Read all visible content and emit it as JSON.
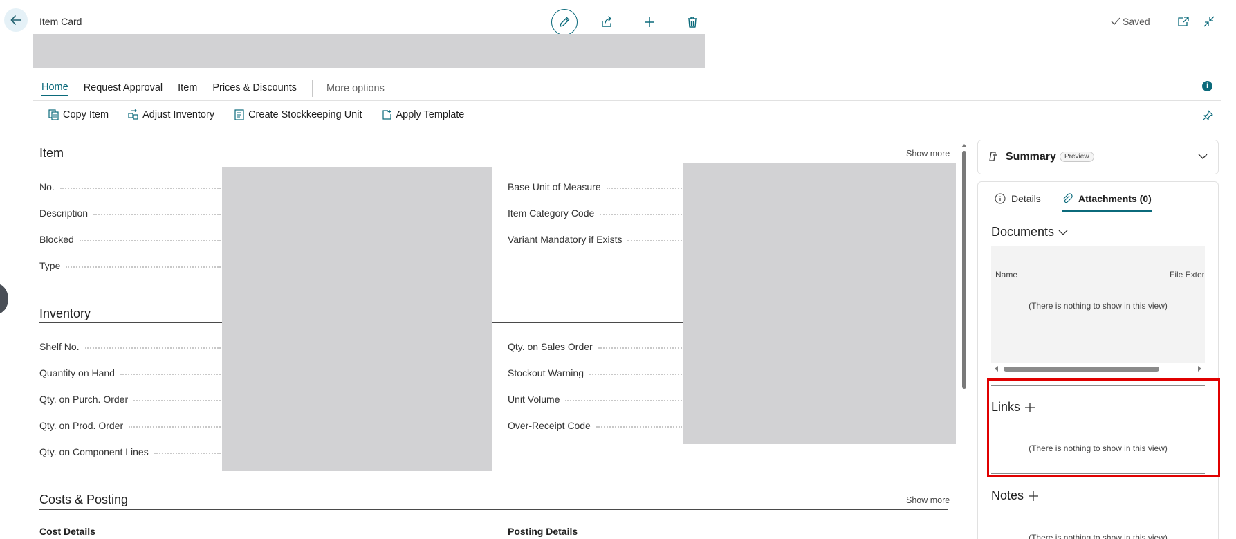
{
  "window": {
    "title": "Item Card",
    "status": "Saved"
  },
  "toolbar": {
    "back_label": "Back",
    "edit_label": "Edit",
    "share_label": "Share",
    "new_label": "New",
    "delete_label": "Delete"
  },
  "nav": {
    "tabs": [
      {
        "label": "Home",
        "active": true
      },
      {
        "label": "Request Approval",
        "active": false
      },
      {
        "label": "Item",
        "active": false
      },
      {
        "label": "Prices & Discounts",
        "active": false
      }
    ],
    "more": "More options"
  },
  "actions": [
    {
      "label": "Copy Item",
      "icon": "copy-icon"
    },
    {
      "label": "Adjust Inventory",
      "icon": "adjust-inventory-icon"
    },
    {
      "label": "Create Stockkeeping Unit",
      "icon": "stockkeeping-icon"
    },
    {
      "label": "Apply Template",
      "icon": "template-icon"
    }
  ],
  "item_section": {
    "title": "Item",
    "show_more": "Show more",
    "left_fields": [
      "No.",
      "Description",
      "Blocked",
      "Type"
    ],
    "right_fields": [
      "Base Unit of Measure",
      "Item Category Code",
      "Variant Mandatory if Exists"
    ]
  },
  "inventory_section": {
    "title": "Inventory",
    "left_fields": [
      "Shelf No.",
      "Quantity on Hand",
      "Qty. on Purch. Order",
      "Qty. on Prod. Order",
      "Qty. on Component Lines"
    ],
    "right_fields": [
      "Qty. on Sales Order",
      "Stockout Warning",
      "Unit Volume",
      "Over-Receipt Code"
    ]
  },
  "costs_section": {
    "title": "Costs & Posting",
    "show_more": "Show more",
    "sub_left": "Cost Details",
    "sub_right": "Posting Details"
  },
  "factbox": {
    "summary_title": "Summary",
    "summary_badge": "Preview",
    "tabs": [
      {
        "label": "Details",
        "icon": "info-icon",
        "active": false
      },
      {
        "label": "Attachments (0)",
        "icon": "paperclip-icon",
        "active": true
      }
    ],
    "documents": {
      "title": "Documents",
      "col_name": "Name",
      "col_ext": "File Exten",
      "empty": "(There is nothing to show in this view)"
    },
    "links": {
      "title": "Links",
      "empty": "(There is nothing to show in this view)"
    },
    "notes": {
      "title": "Notes",
      "empty": "(There is nothing to show in this view)"
    }
  },
  "colors": {
    "accent": "#0b6a7b",
    "highlight": "#e00000",
    "redaction": "#d2d2d4"
  }
}
